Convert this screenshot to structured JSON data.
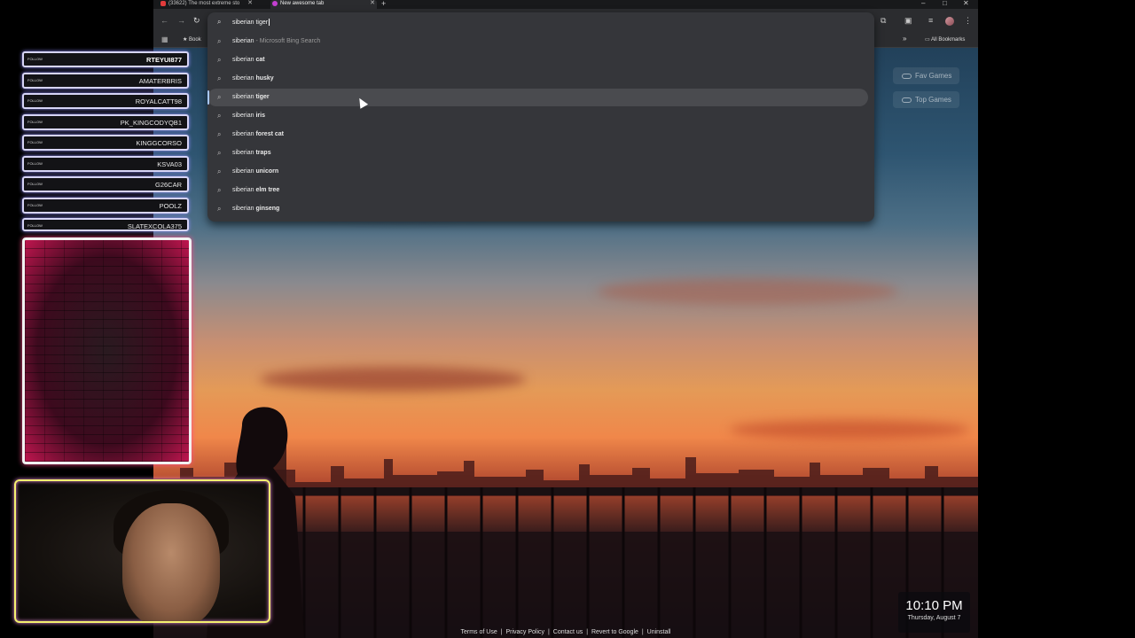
{
  "browser": {
    "tabs": [
      {
        "title": "(33622) The most extreme sto",
        "favicon_color": "#e23b3b",
        "active": false
      },
      {
        "title": "New awesome tab",
        "favicon_color": "#c43fd1",
        "active": true
      }
    ],
    "new_tab": "+",
    "window_controls": [
      "–",
      "□",
      "✕"
    ],
    "bookmarks_bar": {
      "apps_icon": "apps-grid-icon",
      "first_item": "Book",
      "overflow": "»",
      "all_bookmarks": "All Bookmarks"
    },
    "omnibox": {
      "query": "siberian tiger",
      "suggestions": [
        {
          "base": "siberian",
          "bold": "",
          "suffix": " - Microsoft Bing Search"
        },
        {
          "base": "siberian ",
          "bold": "cat",
          "suffix": ""
        },
        {
          "base": "siberian ",
          "bold": "husky",
          "suffix": ""
        },
        {
          "base": "siberian ",
          "bold": "tiger",
          "suffix": "",
          "selected": true
        },
        {
          "base": "siberian ",
          "bold": "iris",
          "suffix": ""
        },
        {
          "base": "siberian ",
          "bold": "forest cat",
          "suffix": ""
        },
        {
          "base": "siberian ",
          "bold": "traps",
          "suffix": ""
        },
        {
          "base": "siberian ",
          "bold": "unicorn",
          "suffix": ""
        },
        {
          "base": "siberian ",
          "bold": "elm tree",
          "suffix": ""
        },
        {
          "base": "siberian ",
          "bold": "ginseng",
          "suffix": ""
        }
      ]
    },
    "page": {
      "side_buttons": [
        "Fav Games",
        "Top Games"
      ],
      "clock": {
        "time": "10:10 PM",
        "date": "Thursday, August 7"
      },
      "footer_links": [
        "Terms of Use",
        "Privacy Policy",
        "Contact us",
        "Revert to Google",
        "Uninstall"
      ],
      "footer_separator": "|"
    }
  },
  "overlay": {
    "follow_tag": "FOLLOW",
    "followers": [
      "RTEYUI877",
      "AMATERBRIS",
      "ROYALCATT98",
      "PK_KINGCODYQB1",
      "KINGGCORSO",
      "KSVA03",
      "G26CAR",
      "POOLZ",
      "SLATEXCOLA375"
    ],
    "colors": {
      "follow_border": "#d6d4f6",
      "brick_glow": "#ff4a8a",
      "webcam_border": "#f4f070"
    }
  }
}
